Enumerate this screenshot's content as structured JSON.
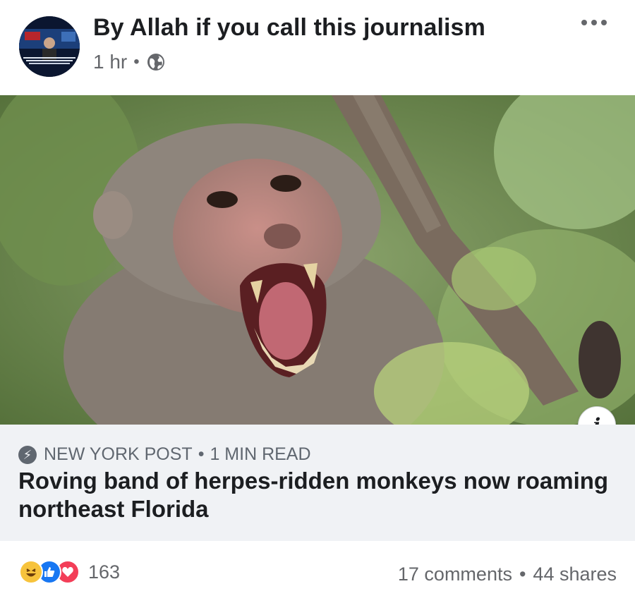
{
  "post": {
    "title": "By Allah if you call this journalism",
    "time": "1 hr",
    "audience_icon": "globe-icon",
    "more_icon": "more-options-icon"
  },
  "link": {
    "source": "NEW YORK POST",
    "read_time": "1 MIN READ",
    "headline": "Roving band of herpes-ridden monkeys now roaming northeast Florida",
    "info_label": "i",
    "source_icon": "lightning-bolt-icon"
  },
  "footer": {
    "reactions": [
      "haha-icon",
      "like-icon",
      "love-icon"
    ],
    "reaction_count": "163",
    "comments": "17 comments",
    "shares": "44 shares"
  },
  "colors": {
    "text": "#1c1e21",
    "muted": "#65676b",
    "link_bg": "#f0f2f5",
    "like": "#1877f2",
    "love": "#f33e58",
    "haha": "#f7c33c"
  }
}
